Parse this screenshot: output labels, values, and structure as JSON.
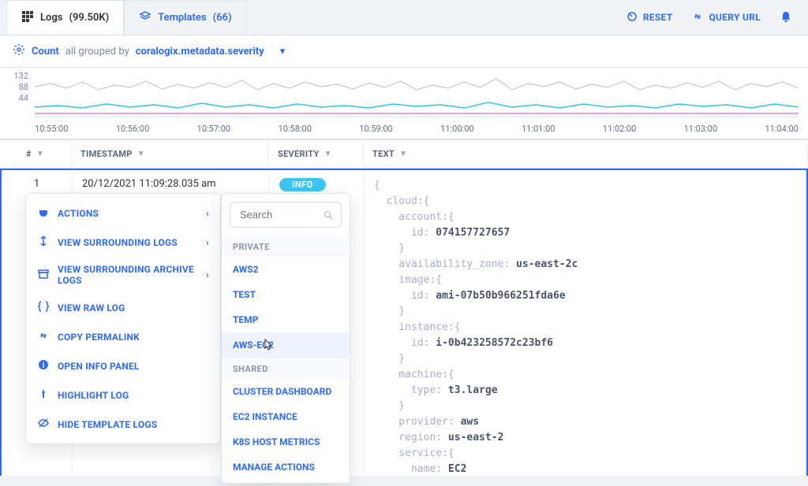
{
  "topbar": {
    "logs_label": "Logs",
    "logs_count": "(99.50K)",
    "templates_label": "Templates",
    "templates_count": "(66)",
    "reset": "RESET",
    "query_url": "QUERY URL"
  },
  "groupbar": {
    "count": "Count",
    "grouped_by": "all grouped by",
    "field": "coralogix.metadata.severity"
  },
  "yaxis": [
    "132",
    "88",
    "44"
  ],
  "xaxis": [
    "10:55:00",
    "10:56:00",
    "10:57:00",
    "10:58:00",
    "10:59:00",
    "11:00:00",
    "11:01:00",
    "11:02:00",
    "11:03:00",
    "11:04:00"
  ],
  "columns": {
    "num": "#",
    "timestamp": "TIMESTAMP",
    "severity": "SEVERITY",
    "text": "TEXT"
  },
  "row": {
    "num": "1",
    "timestamp": "20/12/2021 11:09:28.035 am",
    "severity": "INFO"
  },
  "log": {
    "l1": "{",
    "l2": "  cloud:{",
    "l3": "    account:{",
    "l4k": "      id: ",
    "l4v": "074157727657",
    "l5": "    }",
    "l6k": "    availability_zone: ",
    "l6v": "us-east-2c",
    "l7": "    image:{",
    "l8k": "      id: ",
    "l8v": "ami-07b50b966251fda6e",
    "l9": "    }",
    "l10": "    instance:{",
    "l11k": "      id: ",
    "l11v": "i-0b423258572c23bf6",
    "l12": "    }",
    "l13": "    machine:{",
    "l14k": "      type: ",
    "l14v": "t3.large",
    "l15": "    }",
    "l16k": "    provider: ",
    "l16v": "aws",
    "l17k": "    region: ",
    "l17v": "us-east-2",
    "l18": "    service:{",
    "l19k": "      name: ",
    "l19v": "EC2"
  },
  "ctx": {
    "actions": "ACTIONS",
    "surrounding": "VIEW SURROUNDING LOGS",
    "archive": "VIEW SURROUNDING ARCHIVE LOGS",
    "raw": "VIEW RAW LOG",
    "permalink": "COPY PERMALINK",
    "info": "OPEN INFO PANEL",
    "highlight": "HIGHLIGHT LOG",
    "hide": "HIDE TEMPLATE LOGS"
  },
  "submenu": {
    "search_placeholder": "Search",
    "private": "PRIVATE",
    "items_private": [
      "AWS2",
      "TEST",
      "TEMP",
      "AWS-EC2"
    ],
    "shared": "SHARED",
    "items_shared": [
      "CLUSTER DASHBOARD",
      "EC2 INSTANCE",
      "K8S HOST METRICS"
    ],
    "manage": "MANAGE ACTIONS"
  }
}
